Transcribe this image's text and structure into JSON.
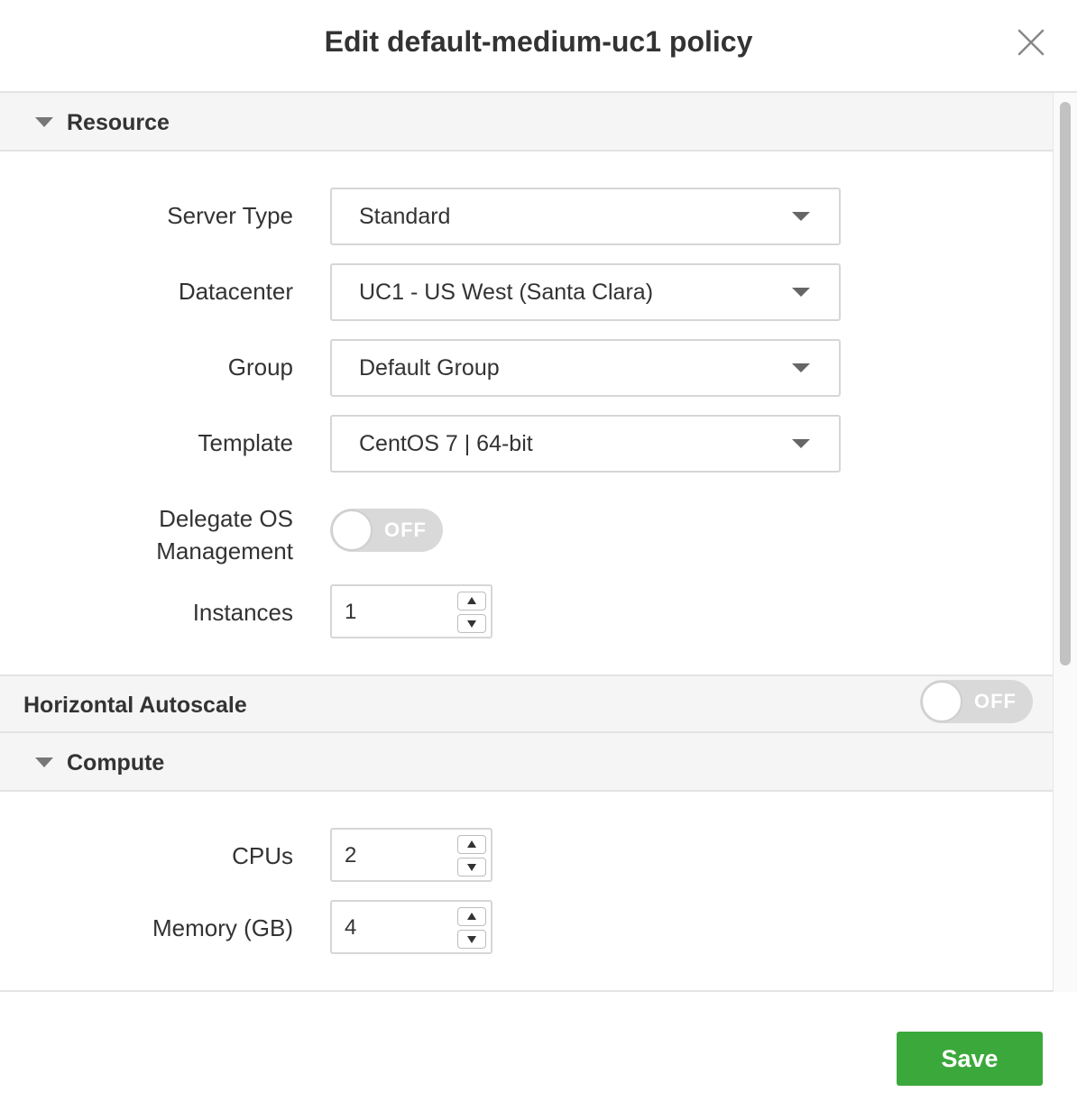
{
  "dialog": {
    "title": "Edit default-medium-uc1 policy"
  },
  "resource_section": {
    "label": "Resource",
    "server_type": {
      "label": "Server Type",
      "value": "Standard"
    },
    "datacenter": {
      "label": "Datacenter",
      "value": "UC1 - US West (Santa Clara)"
    },
    "group": {
      "label": "Group",
      "value": "Default Group"
    },
    "template": {
      "label": "Template",
      "value": "CentOS 7 | 64-bit"
    },
    "delegate_os": {
      "label_line1": "Delegate OS",
      "label_line2": "Management",
      "state": "OFF"
    },
    "instances": {
      "label": "Instances",
      "value": "1"
    }
  },
  "horizontal_autoscale": {
    "label": "Horizontal Autoscale",
    "state": "OFF"
  },
  "compute_section": {
    "label": "Compute",
    "cpus": {
      "label": "CPUs",
      "value": "2"
    },
    "memory": {
      "label": "Memory (GB)",
      "value": "4"
    }
  },
  "footer": {
    "save_label": "Save"
  },
  "colors": {
    "save_button": "#3ba83b",
    "toggle_off": "#d9d9d9",
    "section_bg": "#f5f5f5"
  }
}
